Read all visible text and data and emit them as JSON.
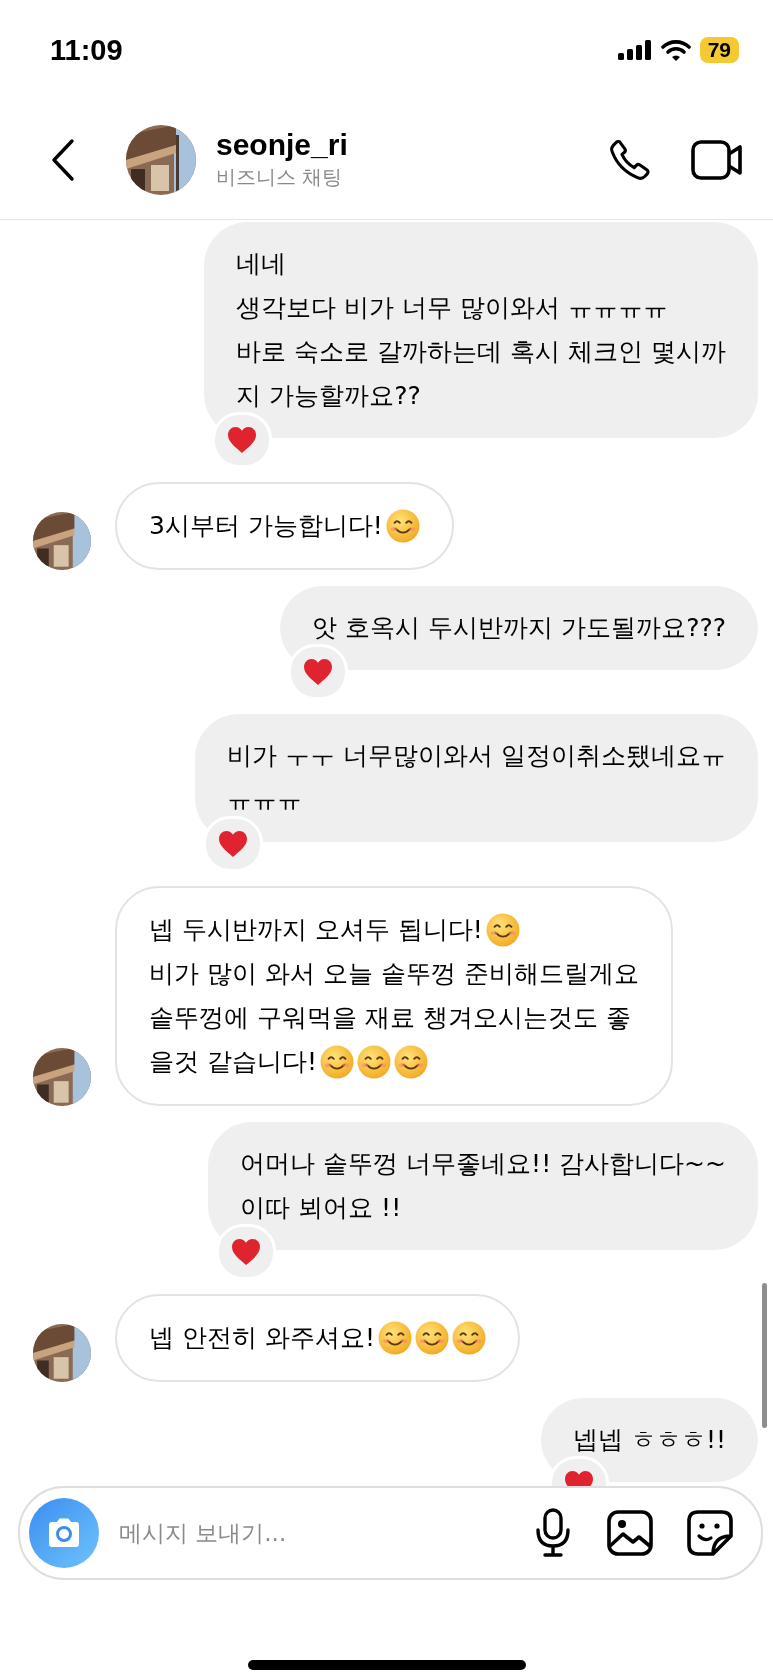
{
  "status_bar": {
    "time": "11:09",
    "battery": "79"
  },
  "header": {
    "username": "seonje_ri",
    "subtitle": "비즈니스 채팅"
  },
  "messages": [
    {
      "sent": true,
      "hearted": true,
      "lines": [
        [
          {
            "kind": "text",
            "text": "네네"
          }
        ],
        [
          {
            "kind": "text",
            "text": "생각보다 비가 너무 많이와서 ㅠㅠㅠㅠ"
          }
        ],
        [
          {
            "kind": "text",
            "text": "바로 숙소로 갈까하는데 혹시 체크인 몇시까"
          }
        ],
        [
          {
            "kind": "text",
            "text": "지 가능할까요??"
          }
        ]
      ]
    },
    {
      "sent": false,
      "hearted": false,
      "lines": [
        [
          {
            "kind": "text",
            "text": "3시부터 가능합니다!"
          },
          {
            "kind": "smiley"
          }
        ]
      ]
    },
    {
      "sent": true,
      "hearted": true,
      "lines": [
        [
          {
            "kind": "text",
            "text": "앗 호옥시 두시반까지 가도될까요???"
          }
        ]
      ]
    },
    {
      "sent": true,
      "hearted": true,
      "lines": [
        [
          {
            "kind": "text",
            "text": "비가 ㅜㅜ 너무많이와서 일정이취소됐네요ㅠ"
          }
        ],
        [
          {
            "kind": "text",
            "text": "ㅠㅠㅠ"
          }
        ]
      ]
    },
    {
      "sent": false,
      "hearted": false,
      "lines": [
        [
          {
            "kind": "text",
            "text": "넵 두시반까지 오셔두 됩니다!"
          },
          {
            "kind": "smiley"
          }
        ],
        [
          {
            "kind": "text",
            "text": "비가 많이 와서 오늘 솥뚜껑 준비해드릴게요"
          }
        ],
        [
          {
            "kind": "text",
            "text": "솥뚜껑에 구워먹을 재료 챙겨오시는것도 좋"
          }
        ],
        [
          {
            "kind": "text",
            "text": "을것 같습니다!"
          },
          {
            "kind": "smiley"
          },
          {
            "kind": "smiley"
          },
          {
            "kind": "smiley"
          }
        ]
      ]
    },
    {
      "sent": true,
      "hearted": true,
      "lines": [
        [
          {
            "kind": "text",
            "text": "어머나 솥뚜껑 너무좋네요!! 감사합니다~~"
          }
        ],
        [
          {
            "kind": "text",
            "text": "이따 뵈어요 !!"
          }
        ]
      ]
    },
    {
      "sent": false,
      "hearted": false,
      "lines": [
        [
          {
            "kind": "text",
            "text": "넵 안전히 와주셔요!"
          },
          {
            "kind": "smiley"
          },
          {
            "kind": "smiley"
          },
          {
            "kind": "smiley"
          }
        ]
      ]
    },
    {
      "sent": true,
      "hearted": true,
      "lines": [
        [
          {
            "kind": "text",
            "text": "넵넵 ㅎㅎㅎ!!"
          }
        ]
      ]
    }
  ],
  "composer": {
    "placeholder": "메시지 보내기..."
  }
}
